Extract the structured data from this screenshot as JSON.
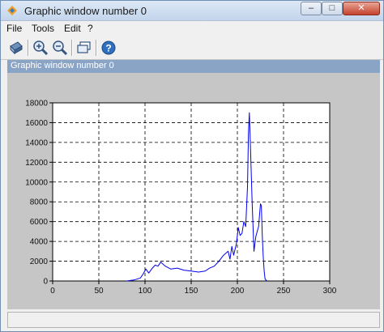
{
  "window": {
    "title": "Graphic window number 0",
    "controls": {
      "minimize": "–",
      "maximize": "□",
      "close": "✕"
    }
  },
  "menu": {
    "items": [
      {
        "id": "file",
        "label": "File"
      },
      {
        "id": "tools",
        "label": "Tools"
      },
      {
        "id": "edit",
        "label": "Edit"
      },
      {
        "id": "help",
        "label": "?"
      }
    ]
  },
  "toolbar": {
    "icons": [
      "rotate-icon",
      "zoom-in-icon",
      "zoom-out-icon",
      "datatip-icon",
      "help-icon"
    ]
  },
  "figure": {
    "title": "Graphic window number 0"
  },
  "colors": {
    "plot_line": "#0000ee",
    "canvas_background": "#c6c6c6",
    "axes_background": "#ffffff",
    "grid": "#000000",
    "figure_title_bar": "#8aa4c6"
  },
  "chart_data": {
    "type": "line",
    "title": "",
    "xlabel": "",
    "ylabel": "",
    "xlim": [
      0,
      300
    ],
    "ylim": [
      0,
      18000
    ],
    "xticks": [
      0,
      50,
      100,
      150,
      200,
      250,
      300
    ],
    "yticks": [
      0,
      2000,
      4000,
      6000,
      8000,
      10000,
      12000,
      14000,
      16000,
      18000
    ],
    "grid": true,
    "grid_style": "dashed",
    "legend": "none",
    "series": [
      {
        "x": [
          80,
          88,
          95,
          98,
          101,
          104,
          108,
          111,
          114,
          117,
          122,
          128,
          135,
          142,
          150,
          158,
          165,
          170,
          175,
          180,
          185,
          190,
          192,
          194,
          196,
          199,
          201,
          203,
          205,
          207,
          209,
          211,
          212,
          213,
          214,
          216,
          218,
          220,
          223,
          225,
          226,
          227,
          228,
          229,
          230,
          232
        ],
        "y": [
          0,
          100,
          300,
          700,
          1200,
          800,
          1300,
          1600,
          1500,
          1900,
          1500,
          1200,
          1300,
          1100,
          1000,
          900,
          1000,
          1300,
          1500,
          2000,
          2600,
          3000,
          2200,
          3500,
          2600,
          3800,
          5400,
          4600,
          4800,
          6000,
          5500,
          9500,
          15000,
          17000,
          14000,
          8000,
          3000,
          4500,
          5500,
          7800,
          7600,
          4500,
          2500,
          1000,
          200,
          0
        ]
      }
    ]
  }
}
